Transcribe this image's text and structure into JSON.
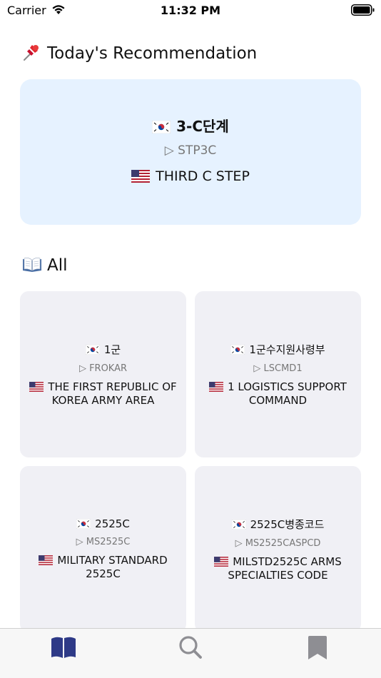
{
  "status_bar": {
    "carrier": "Carrier",
    "time": "11:32 PM"
  },
  "recommendation": {
    "section_title": "Today's Recommendation",
    "section_icon": "pushpin-icon",
    "korean": "3-C단계",
    "code": "▷ STP3C",
    "english": "THIRD C STEP"
  },
  "all": {
    "section_title": "All",
    "section_icon": "open-book-icon",
    "items": [
      {
        "korean": "1군",
        "code": "▷ FROKAR",
        "english": "THE FIRST REPUBLIC OF KOREA ARMY AREA"
      },
      {
        "korean": "1군수지원사령부",
        "code": "▷ LSCMD1",
        "english": "1 LOGISTICS SUPPORT COMMAND"
      },
      {
        "korean": "2525C",
        "code": "▷ MS2525C",
        "english": "MILITARY STANDARD 2525C"
      },
      {
        "korean": "2525C병종코드",
        "code": "▷ MS2525CASPCD",
        "english": "MILSTD2525C ARMS SPECIALTIES CODE"
      }
    ]
  },
  "tab_bar": {
    "tabs": [
      {
        "icon": "book-icon",
        "selected": true
      },
      {
        "icon": "magnifying-glass-icon",
        "selected": false
      },
      {
        "icon": "bookmark-icon",
        "selected": false
      }
    ]
  },
  "colors": {
    "accent": "#2e3a87",
    "recommendation_bg": "#e6f2ff",
    "tile_bg": "#f0f0f5",
    "secondary_text": "#777777",
    "inactive_icon": "#8e8e93"
  }
}
